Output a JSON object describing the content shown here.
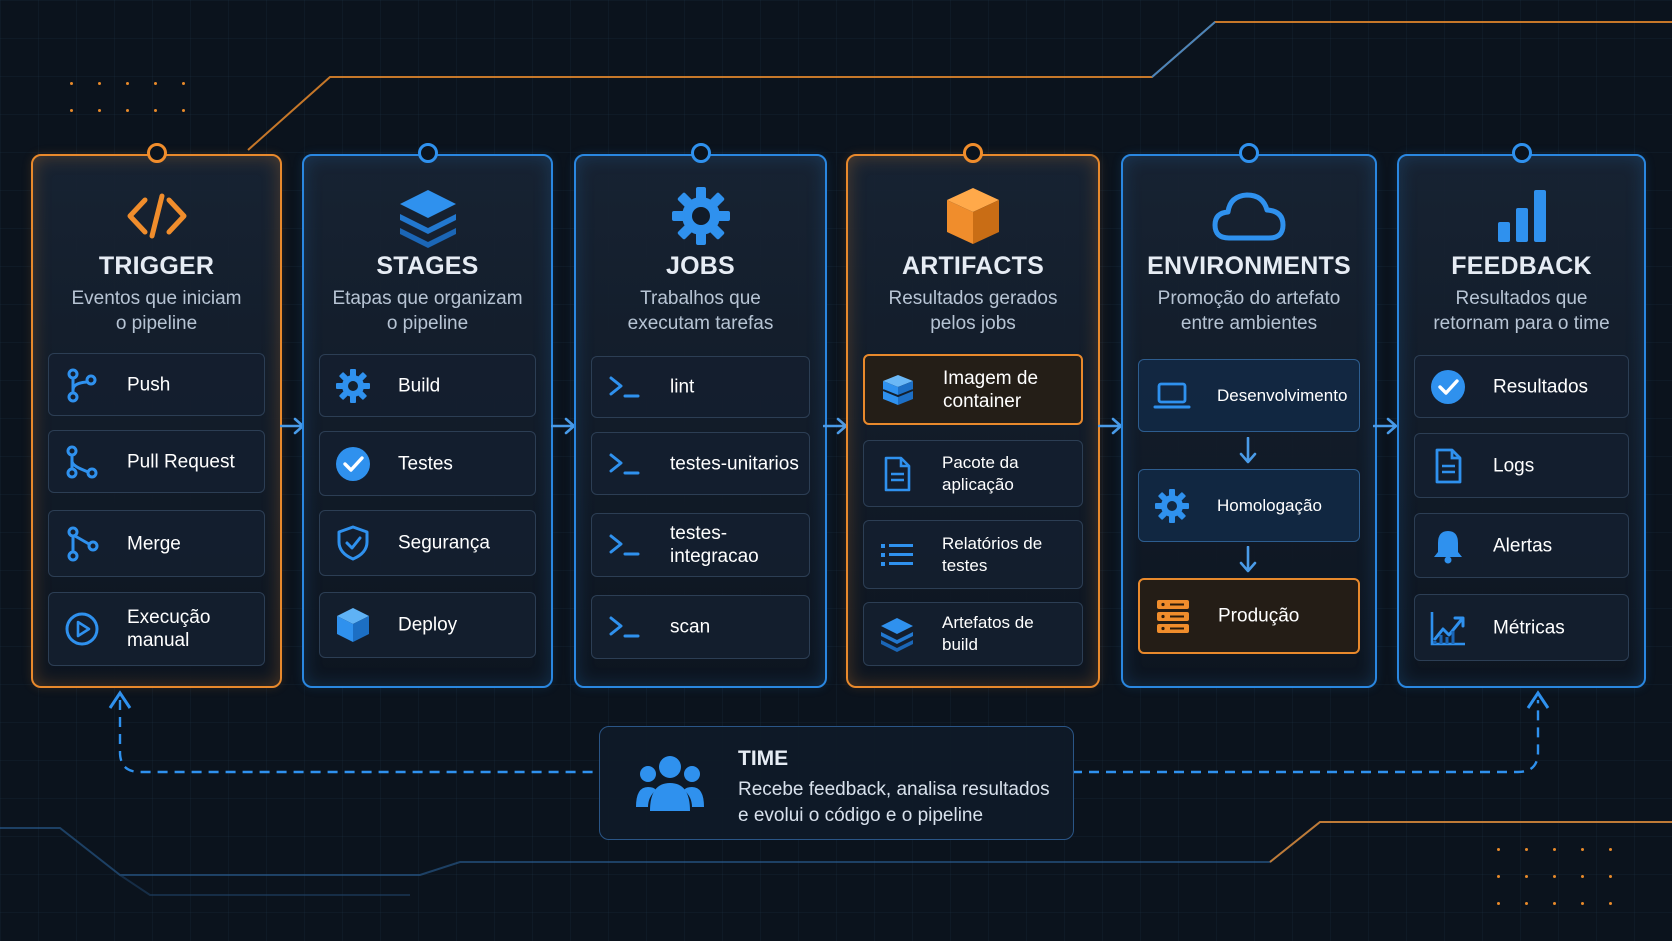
{
  "columns": [
    {
      "id": "trigger",
      "accent": "orange",
      "icon": "code-icon",
      "title": "TRIGGER",
      "subtitle_lines": [
        "Eventos que iniciam",
        "o pipeline"
      ],
      "items": [
        {
          "icon": "git-branch-icon",
          "label": "Push"
        },
        {
          "icon": "pull-request-icon",
          "label": "Pull Request"
        },
        {
          "icon": "merge-icon",
          "label": "Merge"
        },
        {
          "icon": "play-circle-icon",
          "label": "Execução manual"
        }
      ]
    },
    {
      "id": "stages",
      "accent": "blue",
      "icon": "layers-icon",
      "title": "STAGES",
      "subtitle_lines": [
        "Etapas que organizam",
        "o pipeline"
      ],
      "items": [
        {
          "icon": "gear-icon",
          "label": "Build"
        },
        {
          "icon": "check-circle-icon",
          "label": "Testes"
        },
        {
          "icon": "shield-icon",
          "label": "Segurança"
        },
        {
          "icon": "cube-icon",
          "label": "Deploy"
        }
      ]
    },
    {
      "id": "jobs",
      "accent": "blue",
      "icon": "gear-icon",
      "title": "JOBS",
      "subtitle_lines": [
        "Trabalhos que",
        "executam tarefas"
      ],
      "items": [
        {
          "icon": "terminal-icon",
          "label": "lint"
        },
        {
          "icon": "terminal-icon",
          "label": "testes-unitarios"
        },
        {
          "icon": "terminal-icon",
          "label": "testes-integracao"
        },
        {
          "icon": "terminal-icon",
          "label": "scan"
        }
      ]
    },
    {
      "id": "artifacts",
      "accent": "orange",
      "icon": "box-icon",
      "title": "ARTIFACTS",
      "subtitle_lines": [
        "Resultados gerados",
        "pelos jobs"
      ],
      "items": [
        {
          "icon": "container-icon",
          "label": "Imagem de container",
          "highlight": "orange"
        },
        {
          "icon": "document-icon",
          "label": "Pacote da aplicação"
        },
        {
          "icon": "list-icon",
          "label": "Relatórios de testes"
        },
        {
          "icon": "layers-icon",
          "label": "Artefatos de build"
        }
      ]
    },
    {
      "id": "environments",
      "accent": "blue",
      "icon": "cloud-icon",
      "title": "ENVIRONMENTS",
      "subtitle_lines": [
        "Promoção do artefato",
        "entre ambientes"
      ],
      "items": [
        {
          "icon": "laptop-icon",
          "label": "Desenvolvimento",
          "highlight": "blue"
        },
        {
          "icon": "gear-icon",
          "label": "Homologação",
          "highlight": "blue"
        },
        {
          "icon": "server-icon",
          "label": "Produção",
          "highlight": "orange"
        }
      ]
    },
    {
      "id": "feedback",
      "accent": "blue",
      "icon": "bar-chart-icon",
      "title": "FEEDBACK",
      "subtitle_lines": [
        "Resultados que",
        "retornam para o time"
      ],
      "items": [
        {
          "icon": "check-circle-icon",
          "label": "Resultados"
        },
        {
          "icon": "document-icon",
          "label": "Logs"
        },
        {
          "icon": "bell-icon",
          "label": "Alertas"
        },
        {
          "icon": "line-chart-icon",
          "label": "Métricas"
        }
      ]
    }
  ],
  "team": {
    "icon": "users-icon",
    "title": "TIME",
    "description_lines": [
      "Recebe feedback, analisa resultados",
      "e evolui o código e o pipeline"
    ]
  },
  "colors": {
    "orange": "#e8892c",
    "blue": "#2a87e0",
    "background": "#0b131d"
  }
}
